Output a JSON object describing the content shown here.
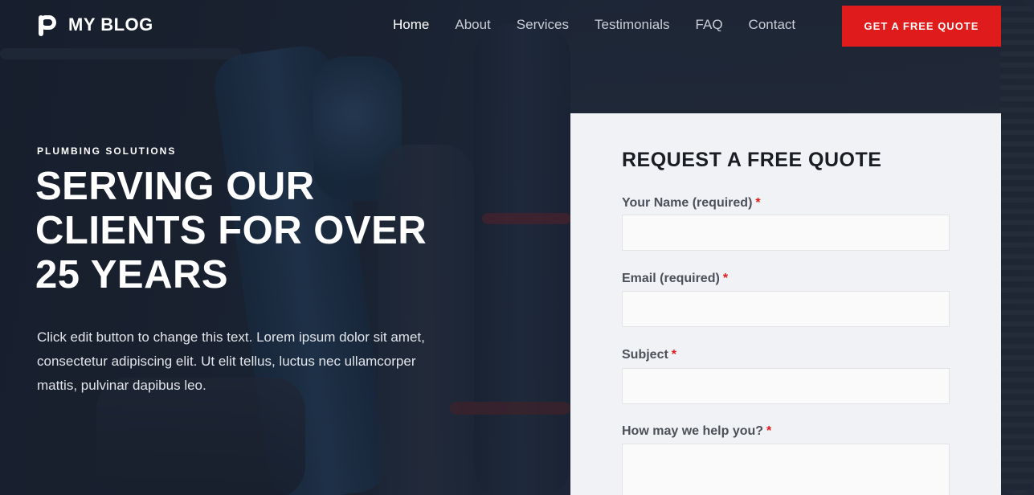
{
  "header": {
    "logo_text": "MY BLOG",
    "nav": [
      "Home",
      "About",
      "Services",
      "Testimonials",
      "FAQ",
      "Contact"
    ],
    "active_nav": "Home",
    "cta_label": "GET A FREE QUOTE",
    "cta_color": "#e01b1b"
  },
  "hero": {
    "eyebrow": "PLUMBING SOLUTIONS",
    "headline_lines": [
      "SERVING OUR",
      "CLIENTS FOR OVER",
      "25 YEARS"
    ],
    "body": "Click edit button to change this text. Lorem ipsum dolor sit amet, consectetur adipiscing elit. Ut elit tellus, luctus nec ullamcorper mattis, pulvinar dapibus leo."
  },
  "form": {
    "title": "REQUEST A FREE QUOTE",
    "required_mark": "*",
    "fields": [
      {
        "label": "Your Name (required)",
        "value": ""
      },
      {
        "label": "Email (required)",
        "value": ""
      },
      {
        "label": "Subject",
        "value": ""
      },
      {
        "label": "How may we help you?",
        "value": ""
      }
    ]
  }
}
